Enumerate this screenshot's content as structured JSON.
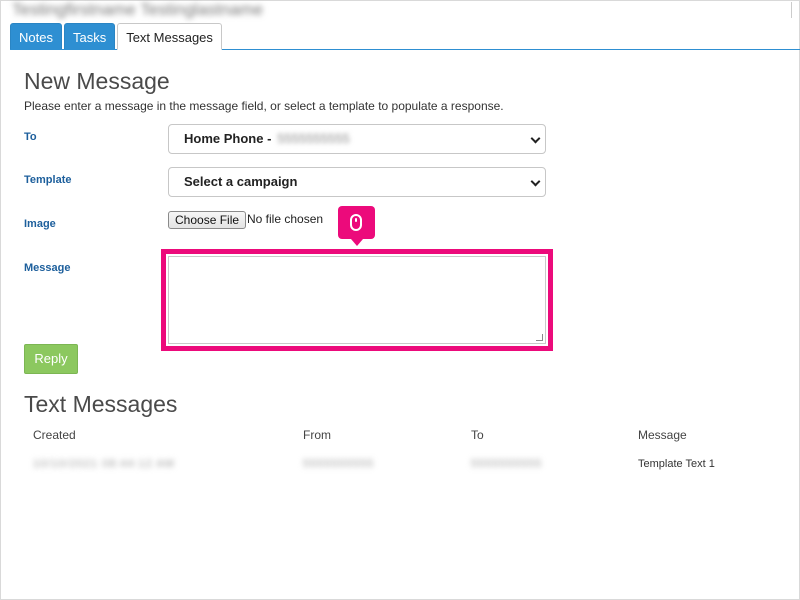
{
  "header": {
    "contact_name": "Testingfirstname Testinglastname"
  },
  "tabs": [
    {
      "label": "Notes"
    },
    {
      "label": "Tasks"
    },
    {
      "label": "Text Messages"
    }
  ],
  "new_message": {
    "title": "New Message",
    "intro": "Please enter a message in the message field, or select a template to populate a response.",
    "to_label": "To",
    "to_value": "Home Phone -",
    "to_value_redacted": "5555555555",
    "template_label": "Template",
    "template_value": "Select a campaign",
    "image_label": "Image",
    "file_button": "Choose File",
    "file_status": "No file chosen",
    "message_label": "Message",
    "message_value": "",
    "reply_button": "Reply"
  },
  "text_messages": {
    "title": "Text Messages",
    "columns": [
      "Created",
      "From",
      "To",
      "Message"
    ],
    "rows": [
      {
        "created": "10/10/2021 08:44:12 AM",
        "from": "5555555555",
        "to": "5555555555",
        "message": "Template Text 1"
      }
    ]
  },
  "colors": {
    "tab_blue": "#2e8fd2",
    "label_blue": "#1d5f9c",
    "highlight_pink": "#ec0a7b",
    "reply_green": "#8cc85f"
  }
}
